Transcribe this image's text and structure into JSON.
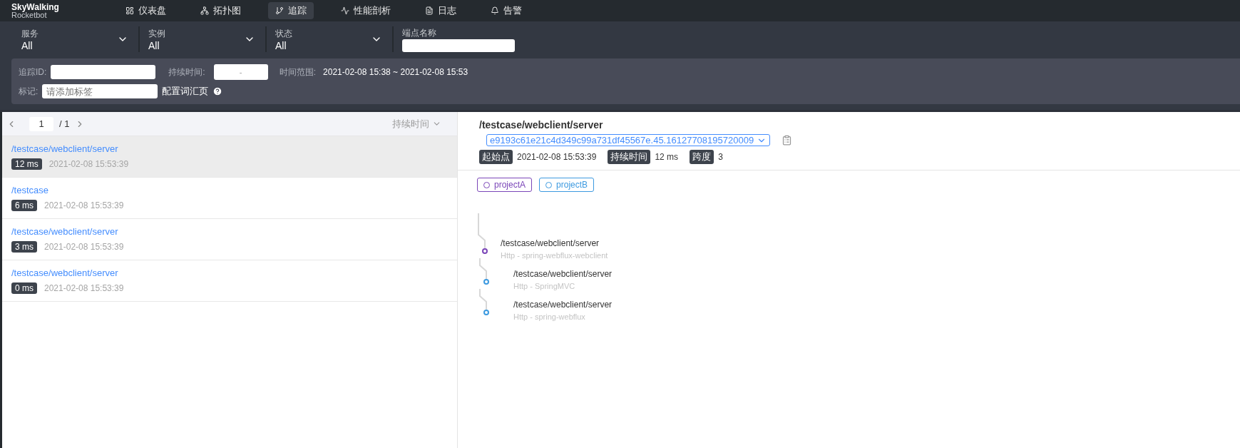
{
  "brand": {
    "name": "SkyWalking",
    "subtitle": "Rocketbot"
  },
  "nav": [
    {
      "label": "仪表盘",
      "kind": "dashboard",
      "selected": false
    },
    {
      "label": "拓扑图",
      "kind": "topology",
      "selected": false
    },
    {
      "label": "追踪",
      "kind": "trace",
      "selected": true
    },
    {
      "label": "性能剖析",
      "kind": "profile",
      "selected": false
    },
    {
      "label": "日志",
      "kind": "log",
      "selected": false
    },
    {
      "label": "告警",
      "kind": "alarm",
      "selected": false
    }
  ],
  "filters": [
    {
      "label": "服务",
      "value": "All",
      "kind": "select"
    },
    {
      "label": "实例",
      "value": "All",
      "kind": "select"
    },
    {
      "label": "状态",
      "value": "All",
      "kind": "select"
    },
    {
      "label": "端点名称",
      "kind": "input"
    }
  ],
  "search": {
    "trace_id_label": "追踪ID:",
    "duration_label": "持续时间:",
    "duration_separator": "-",
    "time_range_label": "时间范围:",
    "time_range": "2021-02-08 15:38 ~ 2021-02-08 15:53",
    "tags_label": "标记:",
    "tags_placeholder": "请添加标签",
    "tags_link": "配置词汇页"
  },
  "pager": {
    "page": "1",
    "total": "/ 1",
    "sort": "持续时间"
  },
  "traces": [
    {
      "endpoint": "/testcase/webclient/server",
      "duration": "12 ms",
      "time": "2021-02-08 15:53:39",
      "selected": true
    },
    {
      "endpoint": "/testcase",
      "duration": "6 ms",
      "time": "2021-02-08 15:53:39",
      "selected": false
    },
    {
      "endpoint": "/testcase/webclient/server",
      "duration": "3 ms",
      "time": "2021-02-08 15:53:39",
      "selected": false
    },
    {
      "endpoint": "/testcase/webclient/server",
      "duration": "0 ms",
      "time": "2021-02-08 15:53:39",
      "selected": false
    }
  ],
  "detail": {
    "title": "/testcase/webclient/server",
    "trace_id": "e9193c61e21c4d349c99a731df45567e.45.16127708195720009",
    "stats": [
      {
        "label": "起始点",
        "value": "2021-02-08 15:53:39"
      },
      {
        "label": "持续时间",
        "value": "12 ms"
      },
      {
        "label": "跨度",
        "value": "3"
      }
    ],
    "services": [
      {
        "name": "projectA",
        "color": "#7b46b8"
      },
      {
        "name": "projectB",
        "color": "#3d9ae0"
      }
    ],
    "tree": [
      {
        "endpoint": "/testcase/webclient/server",
        "component": "Http - spring-webflux-webclient",
        "color": "#7b46b8",
        "children": [
          {
            "endpoint": "/testcase/webclient/server",
            "component": "Http - SpringMVC",
            "color": "#3d9ae0"
          },
          {
            "endpoint": "/testcase/webclient/server",
            "component": "Http - spring-webflux",
            "color": "#3d9ae0"
          }
        ]
      }
    ]
  }
}
